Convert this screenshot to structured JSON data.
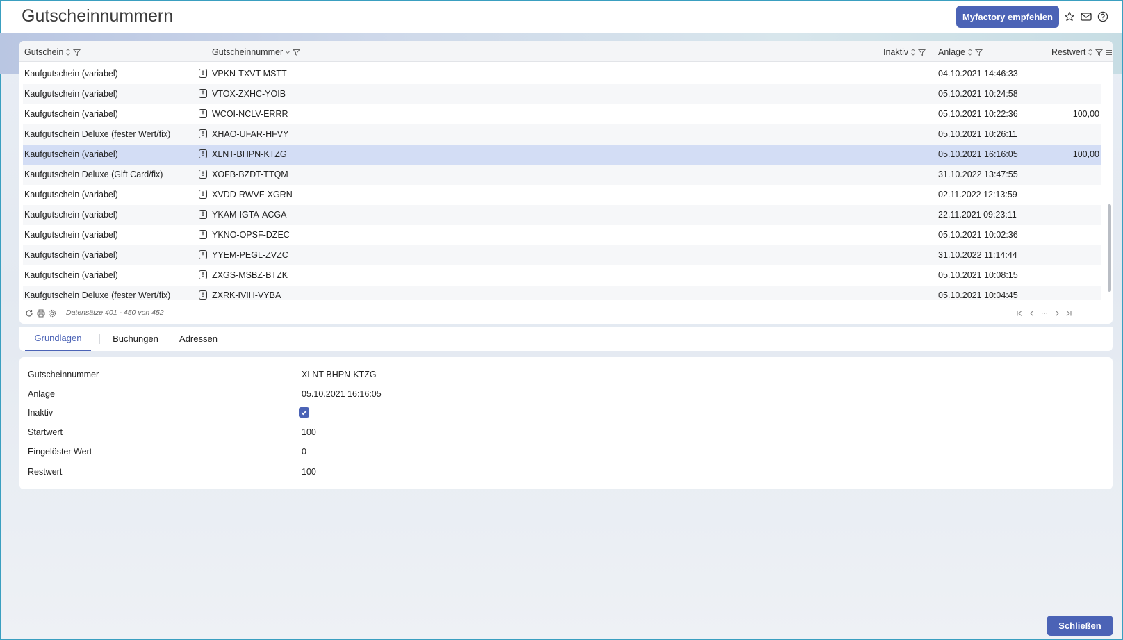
{
  "header": {
    "title": "Gutscheinnummern",
    "recommend_label": "Myfactory empfehlen",
    "icons": [
      "star-icon",
      "mail-icon",
      "help-icon"
    ]
  },
  "grid": {
    "columns": {
      "gutschein": "Gutschein",
      "gutscheinnummer": "Gutscheinnummer",
      "inaktiv": "Inaktiv",
      "anlage": "Anlage",
      "restwert": "Restwert"
    },
    "rows": [
      {
        "gutschein": "Kaufgutschein (variabel)",
        "nummer": "VPKN-TXVT-MSTT",
        "anlage": "04.10.2021 14:46:33",
        "restwert": ""
      },
      {
        "gutschein": "Kaufgutschein (variabel)",
        "nummer": "VTOX-ZXHC-YOIB",
        "anlage": "05.10.2021 10:24:58",
        "restwert": ""
      },
      {
        "gutschein": "Kaufgutschein (variabel)",
        "nummer": "WCOI-NCLV-ERRR",
        "anlage": "05.10.2021 10:22:36",
        "restwert": "100,00"
      },
      {
        "gutschein": "Kaufgutschein Deluxe (fester Wert/fix)",
        "nummer": "XHAO-UFAR-HFVY",
        "anlage": "05.10.2021 10:26:11",
        "restwert": ""
      },
      {
        "gutschein": "Kaufgutschein (variabel)",
        "nummer": "XLNT-BHPN-KTZG",
        "anlage": "05.10.2021 16:16:05",
        "restwert": "100,00"
      },
      {
        "gutschein": "Kaufgutschein Deluxe (Gift Card/fix)",
        "nummer": "XOFB-BZDT-TTQM",
        "anlage": "31.10.2022 13:47:55",
        "restwert": ""
      },
      {
        "gutschein": "Kaufgutschein (variabel)",
        "nummer": "XVDD-RWVF-XGRN",
        "anlage": "02.11.2022 12:13:59",
        "restwert": ""
      },
      {
        "gutschein": "Kaufgutschein (variabel)",
        "nummer": "YKAM-IGTA-ACGA",
        "anlage": "22.11.2021 09:23:11",
        "restwert": ""
      },
      {
        "gutschein": "Kaufgutschein (variabel)",
        "nummer": "YKNO-OPSF-DZEC",
        "anlage": "05.10.2021 10:02:36",
        "restwert": ""
      },
      {
        "gutschein": "Kaufgutschein (variabel)",
        "nummer": "YYEM-PEGL-ZVZC",
        "anlage": "31.10.2022 11:14:44",
        "restwert": ""
      },
      {
        "gutschein": "Kaufgutschein (variabel)",
        "nummer": "ZXGS-MSBZ-BTZK",
        "anlage": "05.10.2021 10:08:15",
        "restwert": ""
      },
      {
        "gutschein": "Kaufgutschein Deluxe (fester Wert/fix)",
        "nummer": "ZXRK-IVIH-VYBA",
        "anlage": "05.10.2021 10:04:45",
        "restwert": ""
      }
    ],
    "selected_row": 4,
    "footer": {
      "records": "Datensätze 401 - 450 von 452",
      "ellipsis": "···"
    }
  },
  "tabs": [
    "Grundlagen",
    "Buchungen",
    "Adressen"
  ],
  "detail": {
    "gutscheinnummer_label": "Gutscheinnummer",
    "gutscheinnummer_value": "XLNT-BHPN-KTZG",
    "anlage_label": "Anlage",
    "anlage_value": "05.10.2021 16:16:05",
    "inaktiv_label": "Inaktiv",
    "inaktiv_checked": true,
    "startwert_label": "Startwert",
    "startwert_value": "100",
    "eingeloest_label": "Eingelöster Wert",
    "eingeloest_value": "0",
    "restwert_label": "Restwert",
    "restwert_value": "100"
  },
  "close_label": "Schließen",
  "colors": {
    "accent": "#4b63b6",
    "selected_row": "#d3ddf5"
  }
}
